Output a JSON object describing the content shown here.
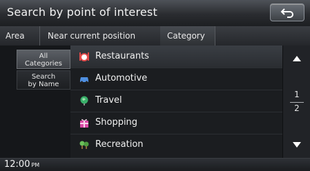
{
  "header": {
    "title": "Search by point of interest",
    "back_icon": "back-arrow-icon"
  },
  "filters": {
    "area_label": "Area",
    "area_value": "Near current position",
    "category_label": "Category"
  },
  "left_menu": {
    "items": [
      {
        "line1": "All",
        "line2": "Categories"
      },
      {
        "line1": "Search",
        "line2": "by Name"
      }
    ]
  },
  "categories": [
    {
      "label": "Restaurants",
      "icon": "restaurant-icon",
      "color": "#e24a4a"
    },
    {
      "label": "Automotive",
      "icon": "car-icon",
      "color": "#4f8fe0"
    },
    {
      "label": "Travel",
      "icon": "globe-icon",
      "color": "#39b06a"
    },
    {
      "label": "Shopping",
      "icon": "gift-icon",
      "color": "#d94aa6"
    },
    {
      "label": "Recreation",
      "icon": "tree-icon",
      "color": "#6bbf5a"
    }
  ],
  "pagination": {
    "current": "1",
    "total": "2"
  },
  "status": {
    "time": "12:00",
    "ampm": "PM"
  }
}
